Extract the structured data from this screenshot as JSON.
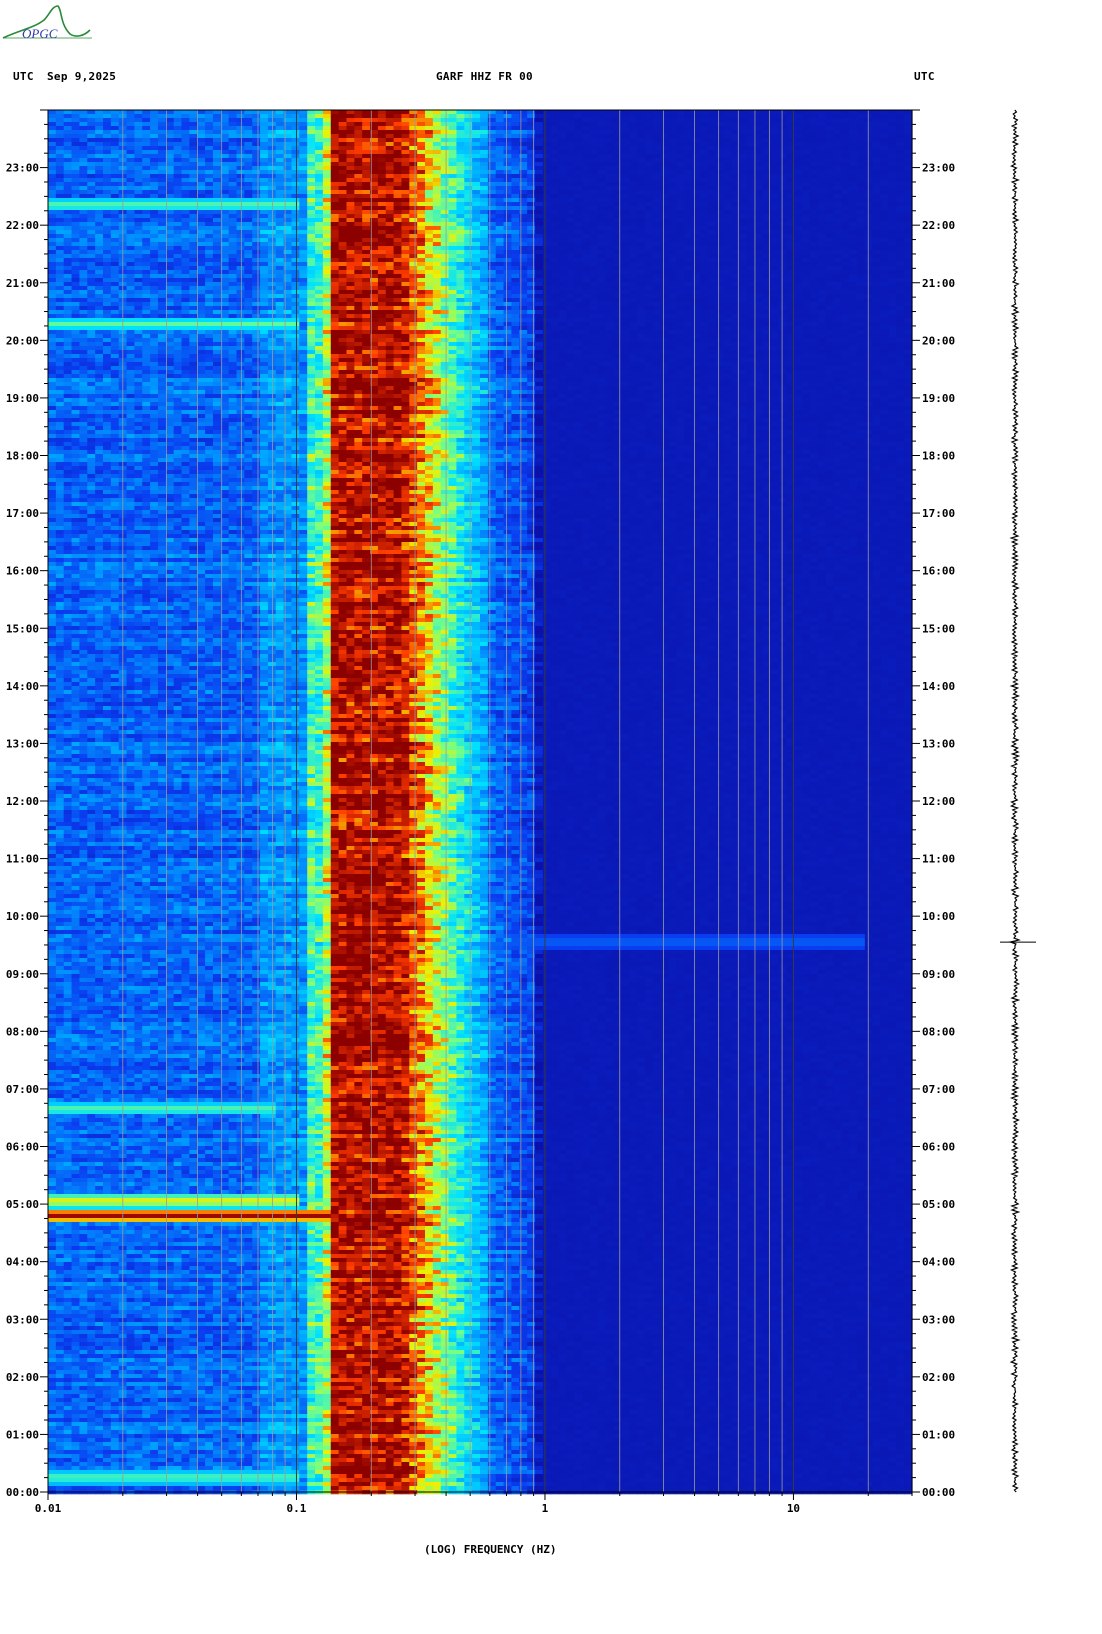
{
  "header": {
    "left_label": "UTC",
    "date": "Sep 9,2025",
    "station": "GARF HHZ FR 00",
    "right_label": "UTC"
  },
  "logo": {
    "text": "OPGC"
  },
  "colors": {
    "background_blue": "#0a10a8",
    "low_blue": "#0a3cf0",
    "cyan": "#00e0ff",
    "yellow": "#f0f000",
    "red": "#ff2000",
    "dark_red": "#8c0000",
    "gridline": "#9a9a9a"
  },
  "chart_data": {
    "type": "heatmap",
    "title": "GARF HHZ FR 00",
    "xlabel": "(LOG) FREQUENCY (HZ)",
    "x_scale": "log",
    "xlim": [
      0.01,
      30
    ],
    "x_ticks": [
      {
        "value": 0.01,
        "label": "0.01"
      },
      {
        "value": 0.1,
        "label": "0.1"
      },
      {
        "value": 1,
        "label": "1"
      },
      {
        "value": 10,
        "label": "10"
      }
    ],
    "y_unit": "UTC hour",
    "ylim": [
      0,
      24
    ],
    "y_ticks": [
      "00:00",
      "01:00",
      "02:00",
      "03:00",
      "04:00",
      "05:00",
      "06:00",
      "07:00",
      "08:00",
      "09:00",
      "10:00",
      "11:00",
      "12:00",
      "13:00",
      "14:00",
      "15:00",
      "16:00",
      "17:00",
      "18:00",
      "19:00",
      "20:00",
      "21:00",
      "22:00",
      "23:00"
    ],
    "grid": true,
    "microseism_band": {
      "f_low": 0.13,
      "f_peak_low": 0.14,
      "f_peak_high": 0.27,
      "f_high": 0.6
    },
    "events": [
      {
        "time_hr": 4.8,
        "f_max": 0.14,
        "intensity": "very high"
      },
      {
        "time_hr": 5.05,
        "f_max": 0.1,
        "intensity": "high"
      },
      {
        "time_hr": 6.65,
        "f_max": 0.08,
        "intensity": "moderate"
      },
      {
        "time_hr": 20.28,
        "f_max": 0.1,
        "intensity": "moderate"
      },
      {
        "time_hr": 22.35,
        "f_max": 0.1,
        "intensity": "moderate"
      },
      {
        "time_hr": 9.55,
        "f_max": 20,
        "intensity": "low"
      },
      {
        "time_hr": 0.25,
        "f_max": 0.1,
        "intensity": "moderate"
      }
    ],
    "seismogram": {
      "baseline_time_hr": [
        0,
        24
      ],
      "spikes": [
        {
          "time_hr": 4.85
        },
        {
          "time_hr": 9.55
        }
      ]
    }
  }
}
